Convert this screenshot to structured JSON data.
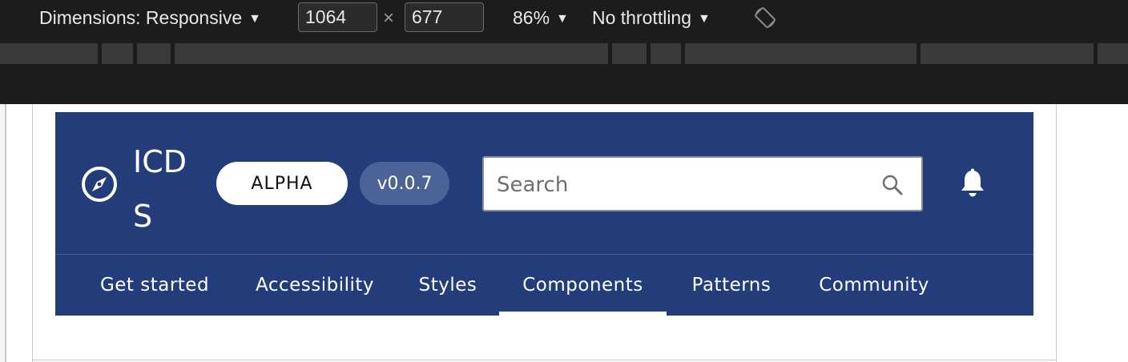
{
  "devtools": {
    "dimensions_label": "Dimensions: Responsive",
    "width_value": "1064",
    "times": "×",
    "height_value": "677",
    "zoom": "86%",
    "throttling": "No throttling",
    "caret": "▼"
  },
  "site": {
    "brand": "ICDS",
    "badge_alpha": "ALPHA",
    "badge_version": "v0.0.7",
    "search_placeholder": "Search",
    "nav": [
      "Get started",
      "Accessibility",
      "Styles",
      "Components",
      "Patterns",
      "Community"
    ],
    "active_nav": "Components",
    "header_color": "#233d7b"
  }
}
